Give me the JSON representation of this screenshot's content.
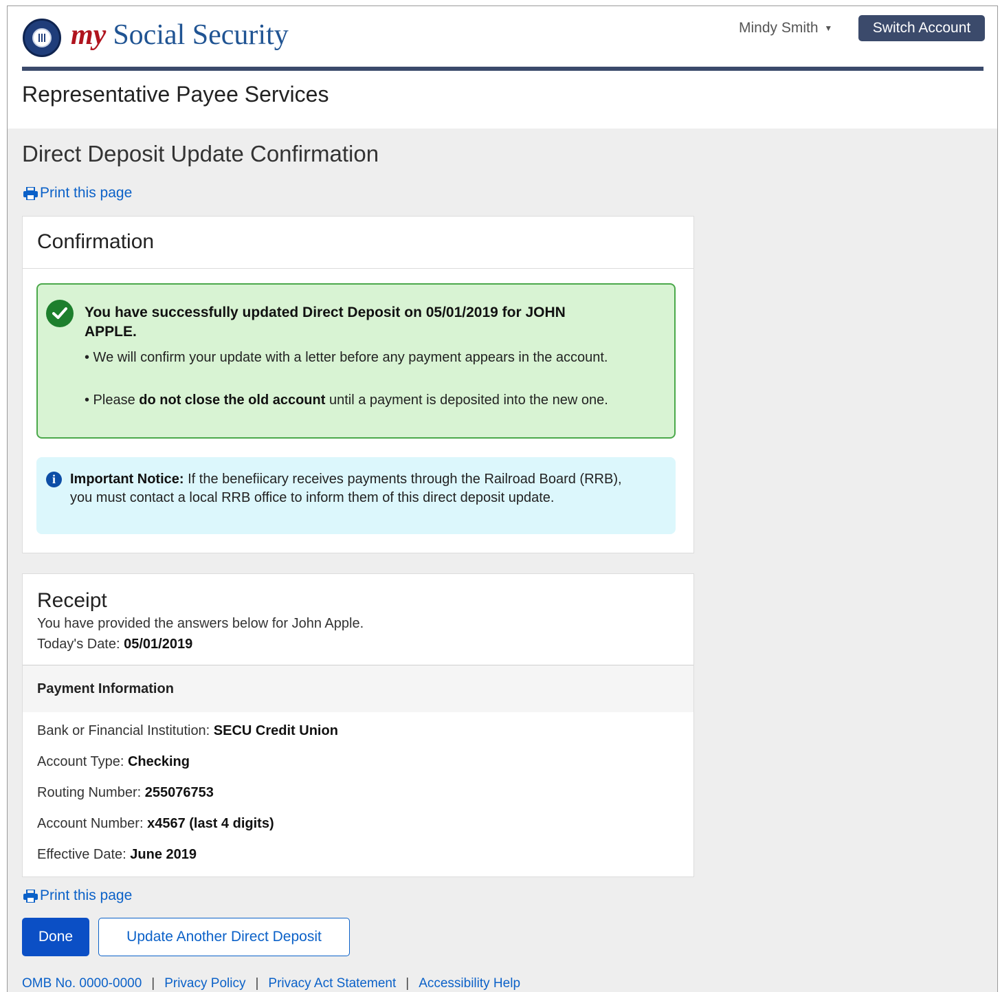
{
  "header": {
    "brand_my": "my",
    "brand_name": "Social Security",
    "user_name": "Mindy Smith",
    "switch_account": "Switch Account",
    "service_title": "Representative Payee Services"
  },
  "page": {
    "title": "Direct Deposit Update Confirmation",
    "print_link": "Print this page"
  },
  "confirmation": {
    "heading": "Confirmation",
    "success_title": "You have successfully updated Direct Deposit on 05/01/2019 for JOHN APPLE.",
    "bullet1": "• We will confirm your update with a letter before any payment appears in the account.",
    "bullet2_pre": "• Please ",
    "bullet2_bold": "do not close the old account",
    "bullet2_post": " until a payment is deposited into the new one.",
    "notice_label": "Important Notice:",
    "notice_text": " If the benefiicary receives payments through the Railroad Board (RRB), you must contact a local RRB office to inform them of this direct deposit update."
  },
  "receipt": {
    "heading": "Receipt",
    "provided": "You have provided the answers below for John Apple.",
    "date_label": "Today's Date: ",
    "date_value": "05/01/2019",
    "section_title": "Payment Information",
    "rows": [
      {
        "label": "Bank or Financial Institution: ",
        "value": "SECU Credit Union"
      },
      {
        "label": "Account Type: ",
        "value": "Checking"
      },
      {
        "label": "Routing Number: ",
        "value": "255076753"
      },
      {
        "label": "Account Number: ",
        "value": "x4567 (last 4 digits)"
      },
      {
        "label": "Effective Date: ",
        "value": "June 2019"
      }
    ]
  },
  "actions": {
    "done": "Done",
    "update_another": "Update Another Direct Deposit"
  },
  "footer": {
    "omb": "OMB No. 0000-0000",
    "privacy_policy": "Privacy Policy",
    "privacy_act": "Privacy Act Statement",
    "accessibility": "Accessibility Help",
    "separator": "|"
  },
  "colors": {
    "brand_navy": "#3b4a6b",
    "link_blue": "#0b61c8",
    "primary_button": "#0b4fc5",
    "success_bg": "#d8f3d3",
    "success_border": "#4aa84a",
    "info_bg": "#dcf7fc"
  },
  "icons": [
    "ssa-seal-logo",
    "caret-down-icon",
    "print-icon",
    "check-circle-icon",
    "info-circle-icon"
  ]
}
